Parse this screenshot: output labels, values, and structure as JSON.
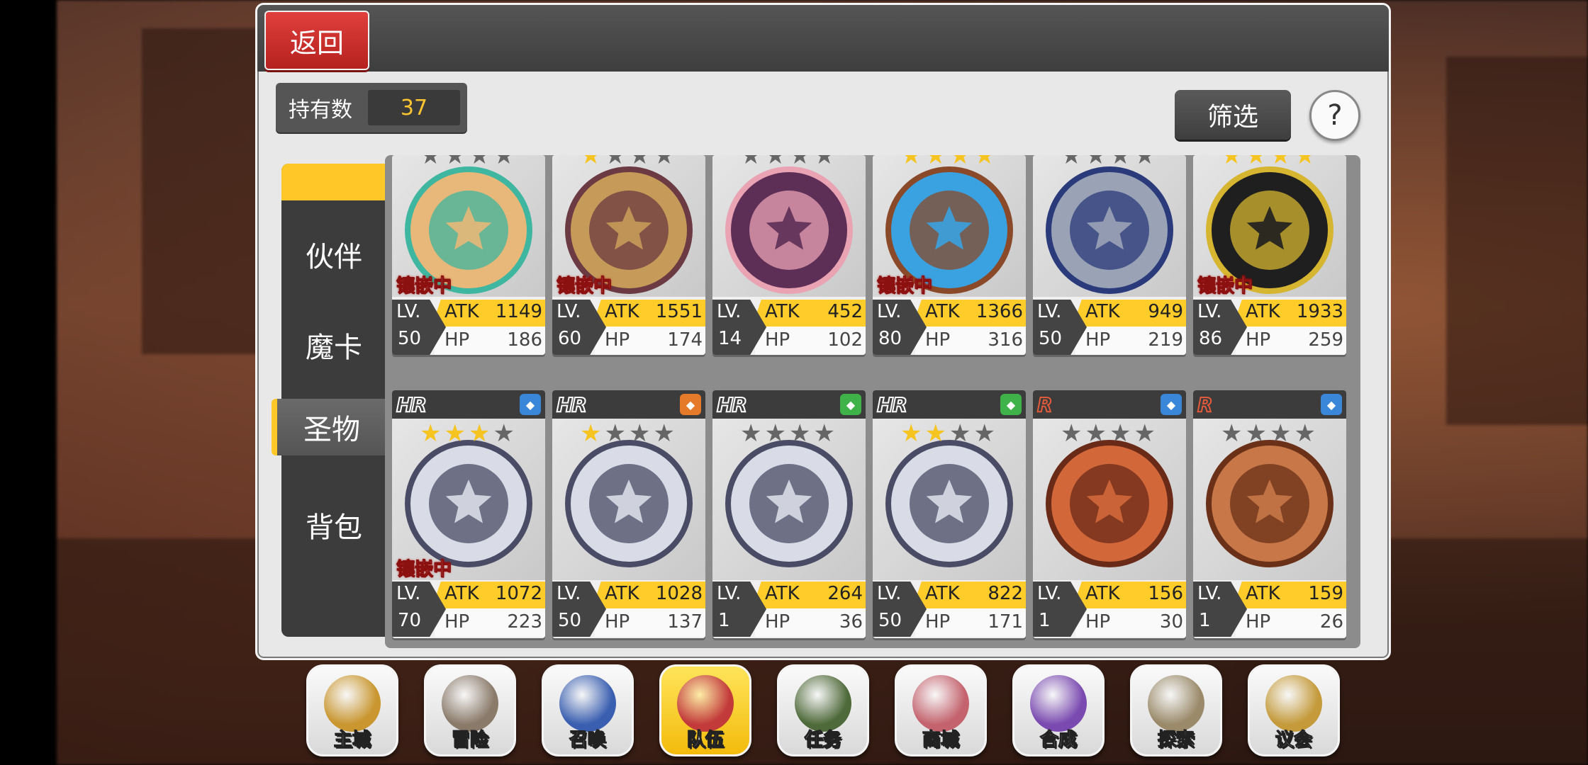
{
  "header": {
    "back_label": "返回"
  },
  "owned": {
    "label": "持有数",
    "count": "37"
  },
  "toolbar": {
    "filter_label": "筛选",
    "help_label": "?"
  },
  "tabs": [
    {
      "label": "伙伴",
      "active": false
    },
    {
      "label": "魔卡",
      "active": false
    },
    {
      "label": "圣物",
      "active": true
    },
    {
      "label": "背包",
      "active": false
    }
  ],
  "row1": [
    {
      "stars_on": 0,
      "stars_total": 4,
      "embedded": true,
      "lv": "50",
      "atk": "1149",
      "hp": "186",
      "art": "emblem-teal",
      "colors": [
        "#e7b879",
        "#3fb6a0"
      ]
    },
    {
      "stars_on": 1,
      "stars_total": 4,
      "embedded": true,
      "lv": "60",
      "atk": "1551",
      "hp": "174",
      "art": "emblem-sun",
      "colors": [
        "#c69a58",
        "#6b3a42"
      ]
    },
    {
      "stars_on": 0,
      "stars_total": 4,
      "embedded": false,
      "lv": "14",
      "atk": "452",
      "hp": "102",
      "art": "emblem-witch",
      "colors": [
        "#5d2f57",
        "#e9a3b3"
      ]
    },
    {
      "stars_on": 4,
      "stars_total": 4,
      "embedded": true,
      "lv": "80",
      "atk": "1366",
      "hp": "316",
      "art": "beast-blue",
      "colors": [
        "#3aa2e0",
        "#8a4a2a"
      ]
    },
    {
      "stars_on": 0,
      "stars_total": 4,
      "embedded": false,
      "lv": "50",
      "atk": "949",
      "hp": "219",
      "art": "emblem-wings",
      "colors": [
        "#9aa3b6",
        "#2a3a7a"
      ]
    },
    {
      "stars_on": 4,
      "stars_total": 4,
      "embedded": true,
      "lv": "86",
      "atk": "1933",
      "hp": "259",
      "art": "emblem-dark",
      "colors": [
        "#1f1f1f",
        "#d6b530"
      ]
    }
  ],
  "row2": [
    {
      "rarity": "HR",
      "element_color": "#3a86d8",
      "stars_on": 3,
      "stars_total": 4,
      "embedded": true,
      "lv": "70",
      "atk": "1072",
      "hp": "223",
      "colors": [
        "#d9dbe7",
        "#4a4c66"
      ]
    },
    {
      "rarity": "HR",
      "element_color": "#e67a2b",
      "stars_on": 1,
      "stars_total": 4,
      "embedded": false,
      "lv": "50",
      "atk": "1028",
      "hp": "137",
      "colors": [
        "#d9dbe7",
        "#4a4c66"
      ]
    },
    {
      "rarity": "HR",
      "element_color": "#3fb34a",
      "stars_on": 0,
      "stars_total": 4,
      "embedded": false,
      "lv": "1",
      "atk": "264",
      "hp": "36",
      "colors": [
        "#d9dbe7",
        "#4a4c66"
      ]
    },
    {
      "rarity": "HR",
      "element_color": "#3fb34a",
      "stars_on": 2,
      "stars_total": 4,
      "embedded": false,
      "lv": "50",
      "atk": "822",
      "hp": "171",
      "colors": [
        "#d9dbe7",
        "#4a4c66"
      ]
    },
    {
      "rarity": "R",
      "element_color": "#3a86d8",
      "stars_on": 0,
      "stars_total": 4,
      "embedded": false,
      "lv": "1",
      "atk": "156",
      "hp": "30",
      "colors": [
        "#d2683a",
        "#6a2a18"
      ]
    },
    {
      "rarity": "R",
      "element_color": "#3a86d8",
      "stars_on": 0,
      "stars_total": 4,
      "embedded": false,
      "lv": "1",
      "atk": "159",
      "hp": "26",
      "colors": [
        "#c87848",
        "#6a3018"
      ]
    }
  ],
  "card_labels": {
    "lv": "LV.",
    "atk": "ATK",
    "hp": "HP",
    "embedded": "镶嵌中"
  },
  "nav": [
    {
      "label": "主城",
      "icon": "crown-icon",
      "color": "#c9962f",
      "active": false
    },
    {
      "label": "冒险",
      "icon": "sword-icon",
      "color": "#8a7a6a",
      "active": false
    },
    {
      "label": "召唤",
      "icon": "card-icon",
      "color": "#3a5fb0",
      "active": false
    },
    {
      "label": "队伍",
      "icon": "wings-icon",
      "color": "#c23a3a",
      "active": true
    },
    {
      "label": "任务",
      "icon": "book-icon",
      "color": "#4f6a3a",
      "active": false
    },
    {
      "label": "商城",
      "icon": "tree-icon",
      "color": "#c4636e",
      "active": false
    },
    {
      "label": "合成",
      "icon": "potion-icon",
      "color": "#7a4ab0",
      "active": false
    },
    {
      "label": "探索",
      "icon": "compass-icon",
      "color": "#9a8a6a",
      "active": false
    },
    {
      "label": "议会",
      "icon": "council-icon",
      "color": "#c49a3a",
      "active": false
    }
  ]
}
